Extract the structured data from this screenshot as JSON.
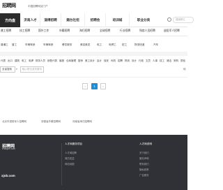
{
  "topbar": {
    "logo": "招聘网",
    "tagline": "中国招聘网站门户"
  },
  "nav": {
    "home": "方向盘",
    "tabs": [
      "济南人才",
      "淄博招聘",
      "烟台社招",
      "招聘会",
      "培训城",
      "职业分类"
    ],
    "search_placeholder": "搜索职位"
  },
  "job_types": [
    "普工招聘",
    "技工招聘",
    "国外工作",
    "外籍招聘",
    "海归招聘",
    "全球招聘",
    "行业招聘",
    "残疾人员招聘",
    "退役军人招聘"
  ],
  "sub_categories": [
    "普通工",
    "普工",
    "车辆驾驶",
    "车辆驾驶",
    "餐饮服务",
    "美容美发",
    "电工",
    "电焊工",
    "钳工",
    "物流快递",
    "汽车"
  ],
  "filters": [
    "代表",
    "出口",
    "建筑",
    "电工",
    "电焊",
    "财务人员",
    "销售代表",
    "客服",
    "仓库管理",
    "厨师",
    "美工设计",
    "会计",
    "保安",
    "司机",
    "招聘",
    "物流",
    "设计",
    "行政",
    "文员",
    "人事",
    "技工",
    "清洁",
    "采购",
    "质检",
    "船员",
    "销售",
    "房产",
    "快递"
  ],
  "search": {
    "province_value": "全省搜索",
    "keyword_placeholder": "输入职位或关键词",
    "edge_text": "地"
  },
  "pager": {
    "prev_label": "‹",
    "current": "1",
    "next_label": "›"
  },
  "related_links": [
    "北京市退役军人招聘网",
    "安徽省外籍招聘网",
    "河南省海归招聘网"
  ],
  "footer": {
    "logo": "招聘网",
    "domain": "zhaopin.com",
    "site": "xjob.com",
    "col1": {
      "title": "人才网服务项目",
      "links": [
        "人才网招聘",
        "简历发送",
        "网站地图"
      ]
    },
    "col2": {
      "title": "人才网说明",
      "links": [
        "关于我们",
        "服务声明",
        "联系我们",
        "隐私政策",
        "广告服务"
      ]
    }
  },
  "colors": {
    "accent": "#1e8fd6",
    "nav_home_bg": "#2b2b2b",
    "footer_bg": "#2f3136"
  },
  "icons": [
    "search-icon",
    "chevron-left-icon",
    "chevron-right-icon",
    "dropdown-arrow-icon"
  ]
}
